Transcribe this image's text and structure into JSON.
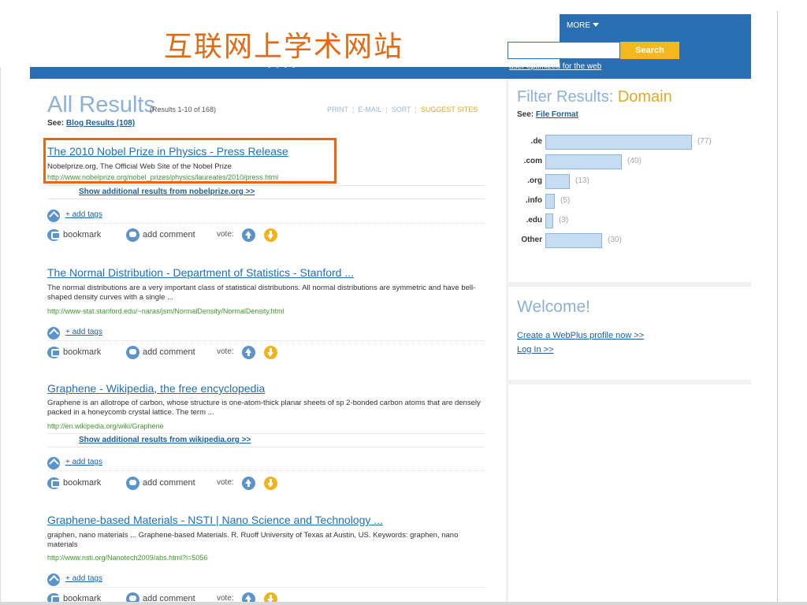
{
  "header": {
    "site_title": "互联网上学术网站",
    "more_label": "MORE",
    "search_placeholder": "",
    "search_button": "Search",
    "optimized_link": "user optimized for the web",
    "dots": "• • • •"
  },
  "results": {
    "heading": "All Results",
    "count": "(Results 1-10 of 168)",
    "actions": [
      "PRINT",
      "E-MAIL",
      "SORT",
      "SUGGEST SITES"
    ],
    "see_prefix": "See:",
    "see_link": "Blog Results (108)",
    "items": [
      {
        "title": "The 2010 Nobel Prize in Physics - Press Release",
        "description": "Nobelprize.org, The Official Web Site of the Nobel Prize",
        "url": "http://www.nobelprize.org/nobel_prizes/physics/laureates/2010/press.html",
        "more": "Show additional results from nobelprize.org >>"
      },
      {
        "title": "The Normal Distribution - Department of Statistics - Stanford ...",
        "description": "The normal distributions are a very important class of statistical distributions. All normal distributions are symmetric and have bell-shaped density curves with a single ...",
        "url": "http://www-stat.stanford.edu/~naras/jsm/NormalDensity/NormalDensity.html",
        "more": ""
      },
      {
        "title": "Graphene - Wikipedia, the free encyclopedia",
        "description": "Graphene is an allotrope of carbon, whose structure is one-atom-thick planar sheets of sp 2-bonded carbon atoms that are densely packed in a honeycomb crystal lattice. The term ...",
        "url": "http://en.wikipedia.org/wiki/Graphene",
        "more": "Show additional results from wikipedia.org >>"
      },
      {
        "title": "Graphene-based Materials - NSTI | Nano Science and Technology ...",
        "description": "graphen, nano materials ... Graphene-based Materials. R. Ruoff University of Texas at Austin, US. Keywords: graphen, nano materials",
        "url": "http://www.nsti.org/Nanotech2009/abs.html?i=5056",
        "more": ""
      }
    ],
    "add_tags": "+ add tags",
    "bookmark": "bookmark",
    "add_comment": "add comment",
    "vote": "vote:"
  },
  "filter": {
    "title_prefix": "Filter Results:",
    "title_accent": "Domain",
    "see_prefix": "See:",
    "see_link": "File Format",
    "rows": [
      {
        "label": ".de",
        "count": "(77)",
        "value": 77
      },
      {
        "label": ".com",
        "count": "(40)",
        "value": 40
      },
      {
        "label": ".org",
        "count": "(13)",
        "value": 13
      },
      {
        "label": ".info",
        "count": "(5)",
        "value": 5
      },
      {
        "label": ".edu",
        "count": "(3)",
        "value": 3
      },
      {
        "label": "Other",
        "count": "(30)",
        "value": 30
      }
    ]
  },
  "welcome": {
    "title": "Welcome!",
    "create_link": "Create a WebPlus profile now >>",
    "login_link": "Log In >>"
  },
  "colors": {
    "brand_blue": "#2a6fb2",
    "title_orange": "#e36a12",
    "highlight": "#ec6512",
    "link_blue": "#1f6fba",
    "url_green": "#3f9b2a",
    "accent_yellow": "#e3a81e"
  }
}
